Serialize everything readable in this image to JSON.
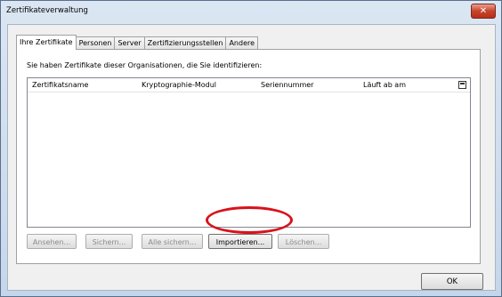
{
  "window": {
    "title": "Zertifikateverwaltung",
    "close_label": "✕"
  },
  "tabs": [
    {
      "label": "Ihre Zertifikate",
      "active": true
    },
    {
      "label": "Personen",
      "active": false
    },
    {
      "label": "Server",
      "active": false
    },
    {
      "label": "Zertifizierungsstellen",
      "active": false
    },
    {
      "label": "Andere",
      "active": false
    }
  ],
  "intro": "Sie haben Zertifikate dieser Organisationen, die Sie identifizieren:",
  "columns": [
    "Zertifikatsname",
    "Kryptographie-Modul",
    "Seriennummer",
    "Läuft ab am"
  ],
  "buttons": {
    "view": "Ansehen...",
    "backup": "Sichern...",
    "backup_all": "Alle sichern...",
    "import": "Importieren...",
    "delete": "Löschen..."
  },
  "ok_label": "OK",
  "colors": {
    "highlight_ellipse": "#d9121a",
    "close_button": "#c7432a"
  }
}
